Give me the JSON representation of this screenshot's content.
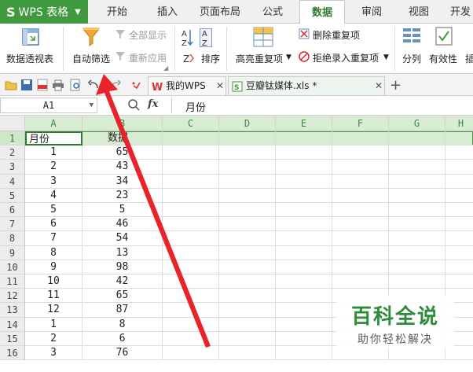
{
  "app": {
    "name": "WPS 表格",
    "logo": "S"
  },
  "menu": {
    "tabs": [
      "开始",
      "插入",
      "页面布局",
      "公式",
      "数据",
      "审阅",
      "视图",
      "开发"
    ],
    "active": "数据"
  },
  "ribbon": {
    "pivot": "数据透视表",
    "autofilter": "自动筛选",
    "show_all": "全部显示",
    "reapply": "重新应用",
    "sort": "排序",
    "highlight_dup": "高亮重复项",
    "remove_dup": "删除重复项",
    "reject_dup": "拒绝录入重复项",
    "split": "分列",
    "validity": "有效性",
    "insert": "插"
  },
  "file_tabs": [
    {
      "label": "我的WPS",
      "active": false
    },
    {
      "label": "豆瓣钛媒体.xls *",
      "active": true
    }
  ],
  "formula_bar": {
    "cell_ref": "A1",
    "fx": "fx",
    "value": "月份"
  },
  "columns": [
    "A",
    "B",
    "C",
    "D",
    "E",
    "F",
    "G",
    "H"
  ],
  "rows": [
    {
      "n": "1",
      "a": "月份",
      "b": "数据"
    },
    {
      "n": "2",
      "a": "1",
      "b": "65"
    },
    {
      "n": "3",
      "a": "2",
      "b": "43"
    },
    {
      "n": "4",
      "a": "3",
      "b": "34"
    },
    {
      "n": "5",
      "a": "4",
      "b": "23"
    },
    {
      "n": "6",
      "a": "5",
      "b": "5"
    },
    {
      "n": "7",
      "a": "6",
      "b": "46"
    },
    {
      "n": "8",
      "a": "7",
      "b": "54"
    },
    {
      "n": "9",
      "a": "8",
      "b": "13"
    },
    {
      "n": "10",
      "a": "9",
      "b": "98"
    },
    {
      "n": "11",
      "a": "10",
      "b": "42"
    },
    {
      "n": "12",
      "a": "11",
      "b": "65"
    },
    {
      "n": "13",
      "a": "12",
      "b": "87"
    },
    {
      "n": "14",
      "a": "1",
      "b": "8"
    },
    {
      "n": "15",
      "a": "2",
      "b": "6"
    },
    {
      "n": "16",
      "a": "3",
      "b": "76"
    }
  ],
  "watermark": {
    "title": "百科全说",
    "subtitle": "助你轻松解决"
  },
  "colors": {
    "accent": "#3f9a3f",
    "arrow": "#e8232a",
    "selection": "#d8ecd4"
  },
  "icons": [
    "pivot-table-icon",
    "funnel-icon",
    "sort-az-icon",
    "highlight-icon",
    "split-icon",
    "validity-icon"
  ]
}
